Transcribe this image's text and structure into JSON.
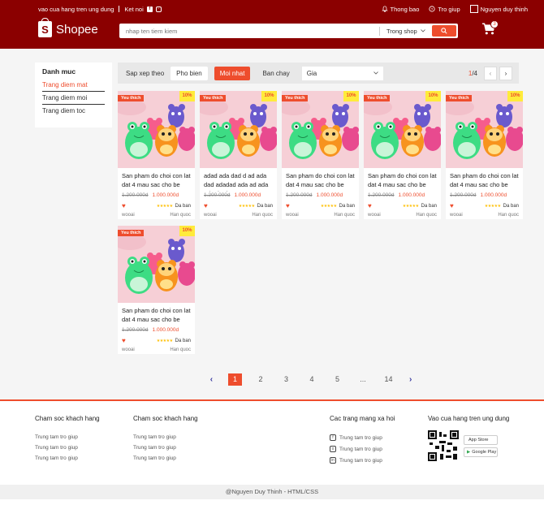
{
  "header": {
    "app_link": "vao cua hang tren ung dung",
    "connect_label": "Ket noi",
    "notifications": "Thong bao",
    "help": "Tro giup",
    "user_name": "Nguyen duy thinh",
    "logo_text": "Shopee",
    "search_placeholder": "nhap ten tiem kiem",
    "search_scope": "Trong shop",
    "cart_count": "3"
  },
  "sidebar": {
    "title": "Danh muc",
    "items": [
      "Trang diem mat",
      "Trang diem moi",
      "Trang diem toc"
    ]
  },
  "filter": {
    "sort_label": "Sap xep theo",
    "options": [
      "Pho bien",
      "Moi nhat",
      "Ban chay"
    ],
    "active": "Moi nhat",
    "price_label": "Gia",
    "page_current": "1",
    "page_total": "/4"
  },
  "products": [
    {
      "name": "San pham do choi con lat dat 4 mau sac cho be",
      "old_price": "1.200.000d",
      "price": "1.000.000d",
      "sold": "Da ban",
      "brand": "wooai",
      "origin": "Han quoc",
      "badge": "Yeu thich",
      "discount": "10%"
    },
    {
      "name": "adad ada dad d ad ada dad adadad ada ad ada ad ad ad",
      "old_price": "1.200.000d",
      "price": "1.000.000d",
      "sold": "Da ban",
      "brand": "wooai",
      "origin": "Han quoc",
      "badge": "Yeu thich",
      "discount": "10%"
    },
    {
      "name": "San pham do choi con lat dat 4 mau sac cho be",
      "old_price": "1.200.000d",
      "price": "1.000.000d",
      "sold": "Da ban",
      "brand": "wooai",
      "origin": "Han quoc",
      "badge": "Yeu thich",
      "discount": "10%"
    },
    {
      "name": "San pham do choi con lat dat 4 mau sac cho be",
      "old_price": "1.200.000d",
      "price": "1.000.000d",
      "sold": "Da ban",
      "brand": "wooai",
      "origin": "Han quoc",
      "badge": "Yeu thich",
      "discount": "10%"
    },
    {
      "name": "San pham do choi con lat dat 4 mau sac cho be",
      "old_price": "1.200.000d",
      "price": "1.000.000d",
      "sold": "Da ban",
      "brand": "wooai",
      "origin": "Han quoc",
      "badge": "Yeu thich",
      "discount": "10%"
    },
    {
      "name": "San pham do choi con lat dat 4 mau sac cho be",
      "old_price": "1.200.000d",
      "price": "1.000.000d",
      "sold": "Da ban",
      "brand": "wooai",
      "origin": "Han quoc",
      "badge": "Yeu thich",
      "discount": "10%"
    }
  ],
  "pagination": {
    "prev": "<",
    "pages": [
      "1",
      "2",
      "3",
      "4",
      "5",
      "...",
      "14"
    ],
    "next": ">"
  },
  "footer": {
    "col1": {
      "title": "Cham soc khach hang",
      "links": [
        "Trung tam tro giup",
        "Trung tam tro giup",
        "Trung tam tro giup"
      ]
    },
    "col2": {
      "title": "Cham soc khach hang",
      "links": [
        "Trung tam tro giup",
        "Trung tam tro giup",
        "Trung tam tro giup"
      ]
    },
    "col3": {
      "title": "Cac trang mang xa hoi",
      "links": [
        "Trung tam tro giup",
        "Trung tam tro giup",
        "Trung tam tro giup"
      ]
    },
    "col4": {
      "title": "Vao cua hang tren ung dung",
      "app_store": "App Store",
      "google_play": "Google Play"
    }
  },
  "copyright": "@Nguyen Duy Thinh - HTML/CSS",
  "colors": {
    "header_bg": "#8b0000",
    "accent": "#ee4d2d"
  }
}
